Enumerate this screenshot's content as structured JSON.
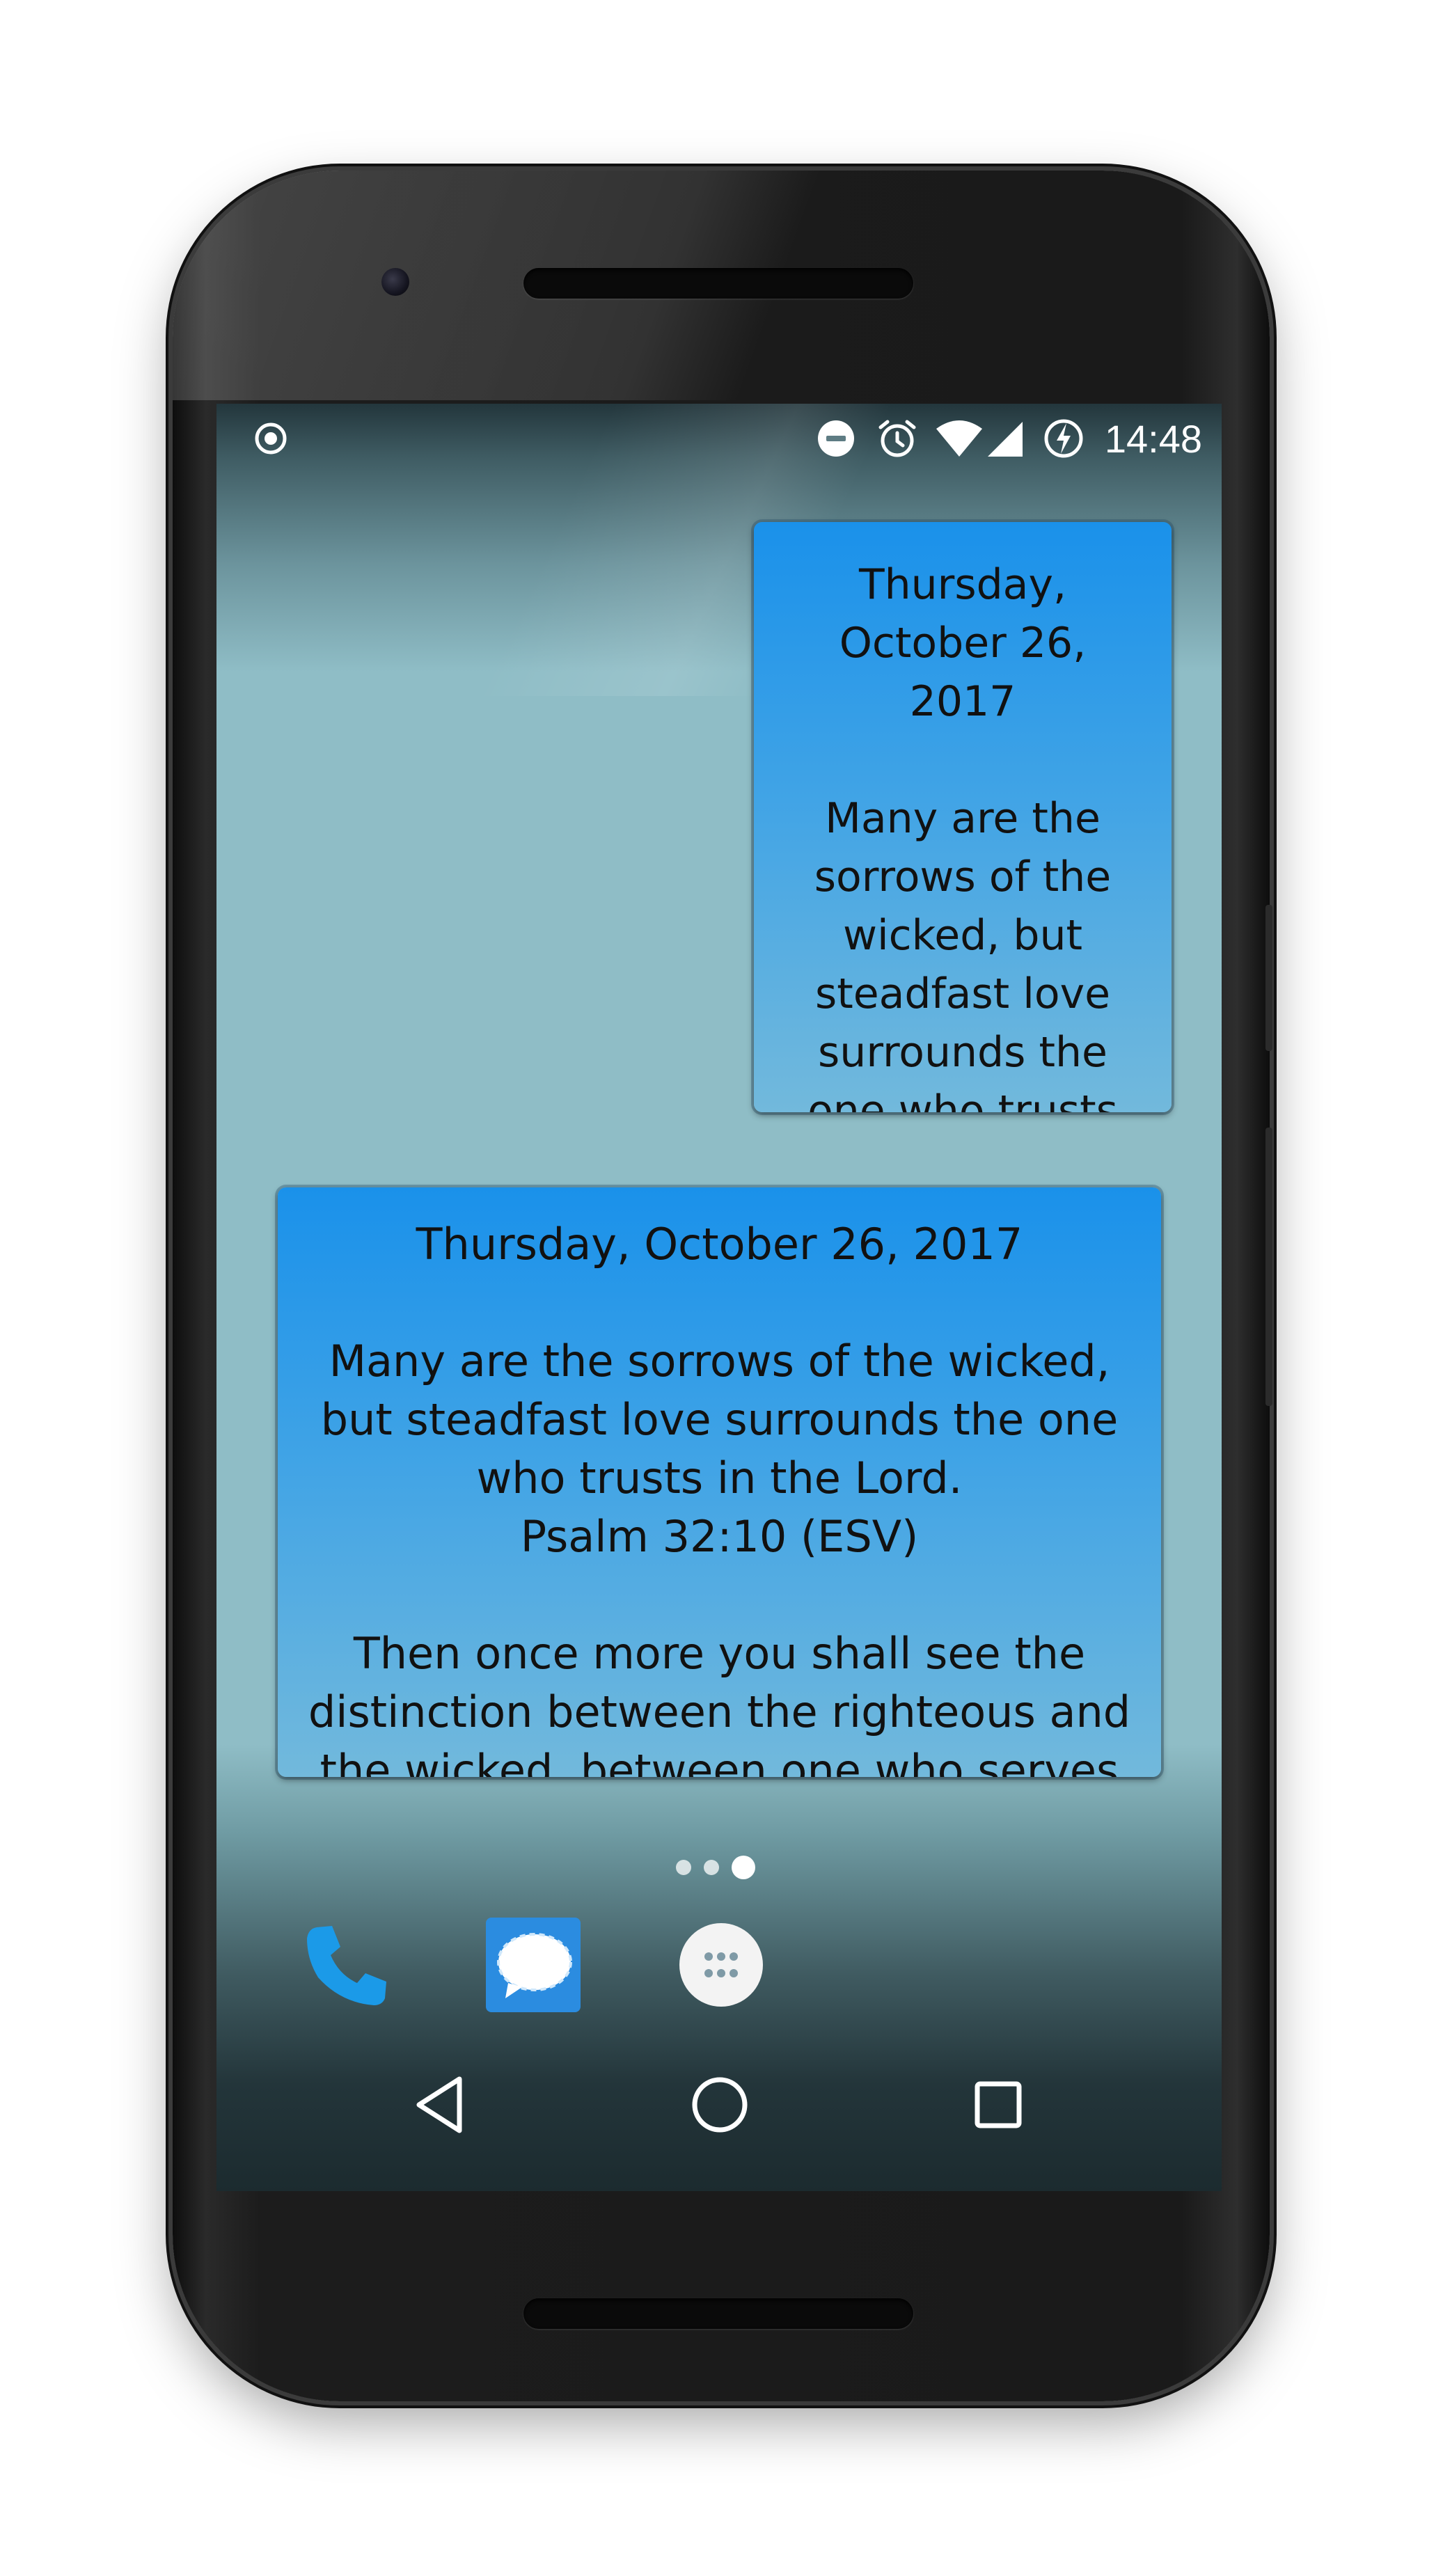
{
  "status_bar": {
    "time": "14:48",
    "icons": [
      "record-icon",
      "do-not-disturb-icon",
      "alarm-icon",
      "wifi-icon",
      "cell-signal-icon",
      "battery-charging-icon"
    ]
  },
  "widgets": {
    "small": {
      "text": "Thursday,\nOctober 26,\n2017\n\nMany are the\nsorrows of the\nwicked, but\nsteadfast love\nsurrounds the\none who trusts"
    },
    "large": {
      "text": "Thursday, October 26, 2017\n\nMany are the sorrows of the wicked,\nbut steadfast love surrounds the one\nwho trusts in the Lord.\nPsalm 32:10 (ESV)\n\nThen once more you shall see the\ndistinction between the righteous and\nthe wicked, between one who serves"
    }
  },
  "page_indicator": {
    "count": 3,
    "active": 3
  },
  "dock": [
    "phone-app-icon",
    "messages-app-icon",
    "app-drawer-icon"
  ],
  "navigation": [
    "back-icon",
    "home-icon",
    "recents-icon"
  ],
  "colors": {
    "widget_top": "#1a91ea",
    "widget_bottom": "#72b9dc",
    "wallpaper": "#8fbdc6",
    "phone_icon": "#1b9ae8",
    "messages_icon": "#2b8ce0"
  }
}
